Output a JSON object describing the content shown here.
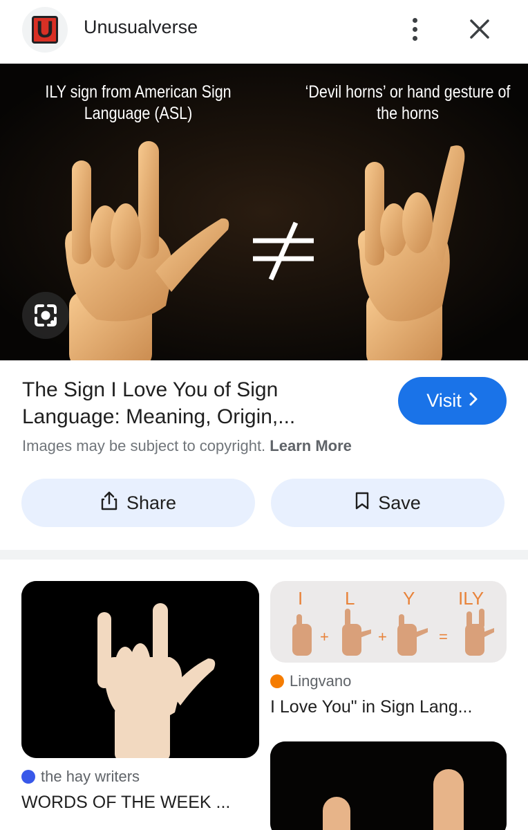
{
  "header": {
    "logo_letter": "U",
    "site_name": "Unusualverse",
    "more_icon": "more-vert-icon",
    "close_icon": "close-icon"
  },
  "hero": {
    "caption_left": "ILY sign from American Sign Language (ASL)",
    "caption_right": "‘Devil horns’ or hand gesture of the horns",
    "symbol": "≠",
    "lens_icon": "google-lens-icon"
  },
  "result": {
    "title": "The Sign I Love You of Sign Language: Meaning, Origin,...",
    "visit_label": "Visit",
    "visit_chevron": "›",
    "copyright_text": "Images may be subject to copyright.",
    "learn_more": "Learn More",
    "share_label": "Share",
    "save_label": "Save"
  },
  "related": [
    {
      "source": "the hay writers",
      "title": "WORDS OF THE WEEK ..."
    },
    {
      "source": "Lingvano",
      "title": "I Love You\" in Sign Lang..."
    }
  ],
  "ily_graphic": {
    "letters": [
      "I",
      "L",
      "Y",
      "ILY"
    ],
    "plus": "+",
    "equals": "="
  },
  "colors": {
    "accent": "#1a73e8",
    "button_bg": "#e8f0fe",
    "logo_red": "#d93025",
    "ily_orange": "#e8833a"
  }
}
